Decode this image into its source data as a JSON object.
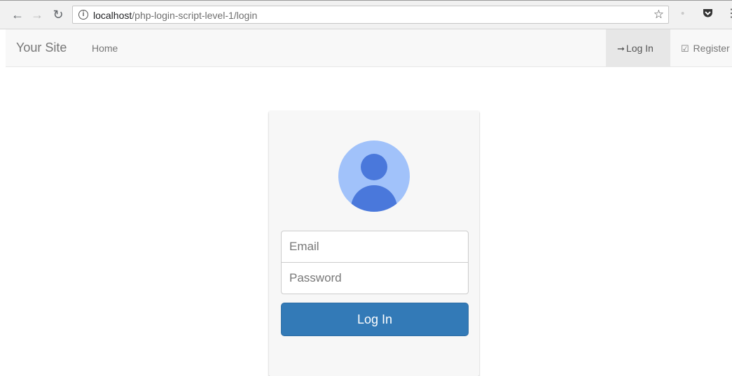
{
  "browser": {
    "url_host": "localhost",
    "url_path": "/php-login-script-level-1/login",
    "info_icon": "i"
  },
  "navbar": {
    "brand": "Your Site",
    "home": "Home",
    "login": "Log In",
    "register": "Register"
  },
  "form": {
    "email_placeholder": "Email",
    "password_placeholder": "Password",
    "submit_label": "Log In"
  },
  "colors": {
    "primary": "#337ab7",
    "avatar_bg": "#a1c2fa",
    "avatar_fg": "#4a78db"
  }
}
